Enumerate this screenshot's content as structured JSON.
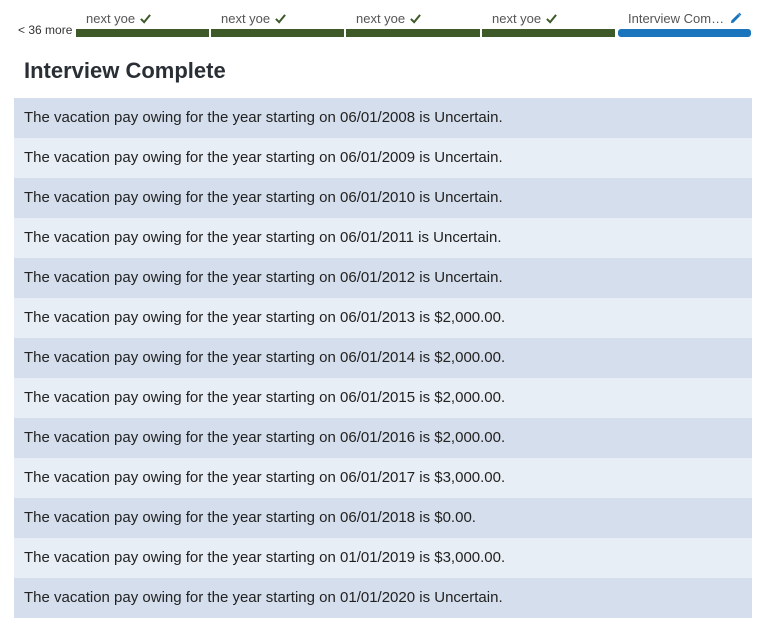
{
  "progress": {
    "more_label": "< 36 more",
    "steps": [
      {
        "label": "next yoe",
        "state": "done"
      },
      {
        "label": "next yoe",
        "state": "done"
      },
      {
        "label": "next yoe",
        "state": "done"
      },
      {
        "label": "next yoe",
        "state": "done"
      },
      {
        "label": "Interview Com…",
        "state": "current"
      }
    ],
    "colors": {
      "done": "#3d5a28",
      "current": "#1a75bc"
    }
  },
  "page": {
    "title": "Interview Complete"
  },
  "results": [
    "The vacation pay owing for the year starting on 06/01/2008 is Uncertain.",
    "The vacation pay owing for the year starting on 06/01/2009 is Uncertain.",
    "The vacation pay owing for the year starting on 06/01/2010 is Uncertain.",
    "The vacation pay owing for the year starting on 06/01/2011 is Uncertain.",
    "The vacation pay owing for the year starting on 06/01/2012 is Uncertain.",
    "The vacation pay owing for the year starting on 06/01/2013 is $2,000.00.",
    "The vacation pay owing for the year starting on 06/01/2014 is $2,000.00.",
    "The vacation pay owing for the year starting on 06/01/2015 is $2,000.00.",
    "The vacation pay owing for the year starting on 06/01/2016 is $2,000.00.",
    "The vacation pay owing for the year starting on 06/01/2017 is $3,000.00.",
    "The vacation pay owing for the year starting on 06/01/2018 is $0.00.",
    "The vacation pay owing for the year starting on 01/01/2019 is $3,000.00.",
    "The vacation pay owing for the year starting on 01/01/2020 is Uncertain."
  ]
}
